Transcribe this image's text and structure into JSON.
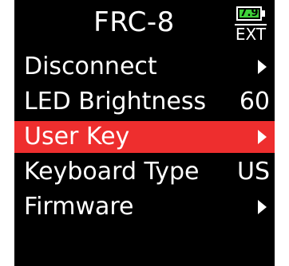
{
  "header": {
    "title": "FRC-8",
    "battery_level": "7.9",
    "power_source": "EXT"
  },
  "menu": {
    "selected_index": 2,
    "items": [
      {
        "label": "Disconnect",
        "value": "",
        "icon": "chevron-right-icon"
      },
      {
        "label": "LED Brightness",
        "value": "60",
        "icon": ""
      },
      {
        "label": "User Key",
        "value": "",
        "icon": "chevron-right-icon"
      },
      {
        "label": "Keyboard Type",
        "value": "US",
        "icon": ""
      },
      {
        "label": "Firmware",
        "value": "",
        "icon": "chevron-right-icon"
      }
    ]
  },
  "colors": {
    "background": "#000000",
    "highlight": "#ee2e2e",
    "battery": "#3fd13a",
    "text": "#ffffff"
  }
}
